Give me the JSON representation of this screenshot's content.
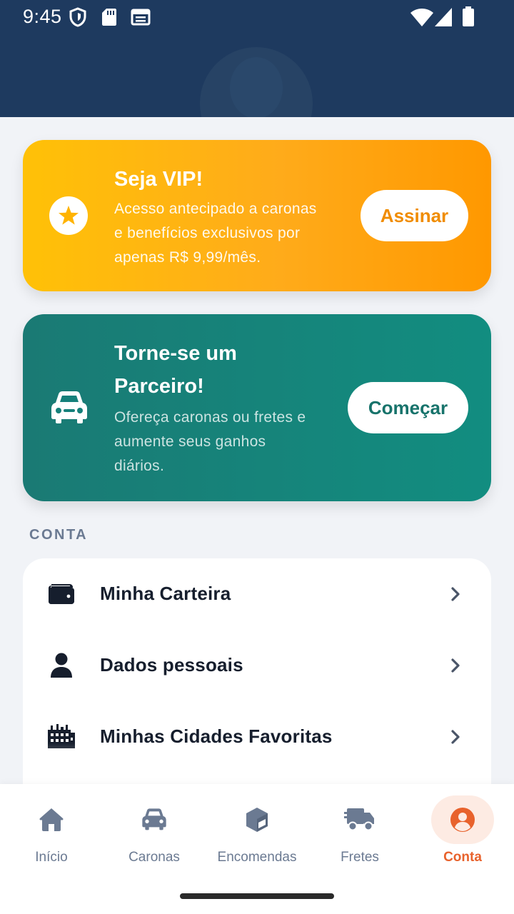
{
  "status_bar": {
    "time": "9:45",
    "left_icons": [
      "shield-icon",
      "sd-card-icon",
      "calendar-icon"
    ],
    "right_icons": [
      "wifi-icon",
      "signal-icon",
      "battery-icon"
    ]
  },
  "colors": {
    "header_bg": "#1e3a5f",
    "vip_gradient": [
      "#ffc107",
      "#ff9800"
    ],
    "vip_accent": "#f08c00",
    "partner_gradient": [
      "#1a7a74",
      "#128d80"
    ],
    "partner_accent": "#17736b",
    "active_nav": "#e8622c",
    "inactive_nav": "#6b7a92"
  },
  "vip_card": {
    "icon": "star-icon",
    "title": "Seja VIP!",
    "desc_lines": [
      "Acesso antecipado a caronas",
      "e benefícios exclusivos por",
      "apenas R$ 9,99/mês."
    ],
    "button": "Assinar"
  },
  "partner_card": {
    "icon": "car-icon",
    "title_lines": [
      "Torne-se um",
      "Parceiro!"
    ],
    "desc_lines": [
      "Ofereça caronas ou fretes e",
      "aumente seus ganhos",
      "diários."
    ],
    "button": "Começar"
  },
  "account_section": {
    "label": "CONTA",
    "items": [
      {
        "icon": "wallet-icon",
        "label": "Minha Carteira"
      },
      {
        "icon": "user-icon",
        "label": "Dados pessoais"
      },
      {
        "icon": "city-icon",
        "label": "Minhas Cidades Favoritas"
      }
    ]
  },
  "bottom_nav": {
    "items": [
      {
        "icon": "home-icon",
        "label": "Início"
      },
      {
        "icon": "car-icon",
        "label": "Caronas"
      },
      {
        "icon": "box-icon",
        "label": "Encomendas"
      },
      {
        "icon": "truck-icon",
        "label": "Fretes"
      },
      {
        "icon": "account-circle-icon",
        "label": "Conta"
      }
    ],
    "active": "Conta"
  }
}
